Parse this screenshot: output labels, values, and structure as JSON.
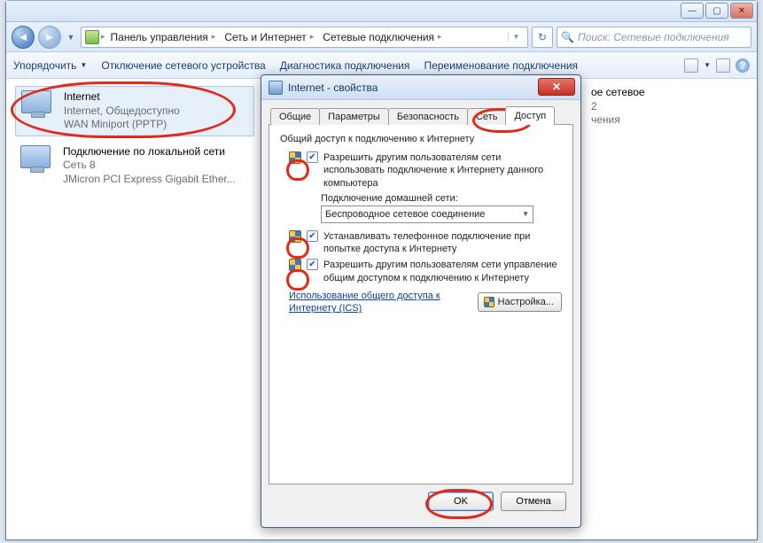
{
  "explorer": {
    "breadcrumb": {
      "items": [
        "Панель управления",
        "Сеть и Интернет",
        "Сетевые подключения"
      ]
    },
    "search": {
      "placeholder": "Поиск: Сетевые подключения"
    },
    "toolbar": {
      "organize": "Упорядочить",
      "disable": "Отключение сетевого устройства",
      "diagnose": "Диагностика подключения",
      "rename": "Переименование подключения"
    },
    "connections": [
      {
        "title": "Internet",
        "status": "Internet, Общедоступно",
        "device": "WAN Miniport (PPTP)"
      },
      {
        "title": "Подключение по локальной сети",
        "status": "Сеть 8",
        "device": "JMicron PCI Express Gigabit Ether..."
      }
    ],
    "rightinfo": {
      "line1": "ое сетевое",
      "line2": "2",
      "line3": "чения"
    }
  },
  "dialog": {
    "title": "Internet - свойства",
    "tabs": [
      "Общие",
      "Параметры",
      "Безопасность",
      "Сеть",
      "Доступ"
    ],
    "active_tab": 4,
    "panel": {
      "group_title": "Общий доступ к подключению к Интернету",
      "opt1": "Разрешить другим пользователям сети использовать подключение к Интернету данного компьютера",
      "home_label": "Подключение домашней сети:",
      "home_value": "Беспроводное сетевое соединение",
      "opt2": "Устанавливать телефонное подключение при попытке доступа к Интернету",
      "opt3": "Разрешить другим пользователям сети управление общим доступом к подключению к Интернету",
      "link": "Использование общего доступа к Интернету (ICS)",
      "config_btn": "Настройка..."
    },
    "buttons": {
      "ok": "OK",
      "cancel": "Отмена"
    }
  }
}
